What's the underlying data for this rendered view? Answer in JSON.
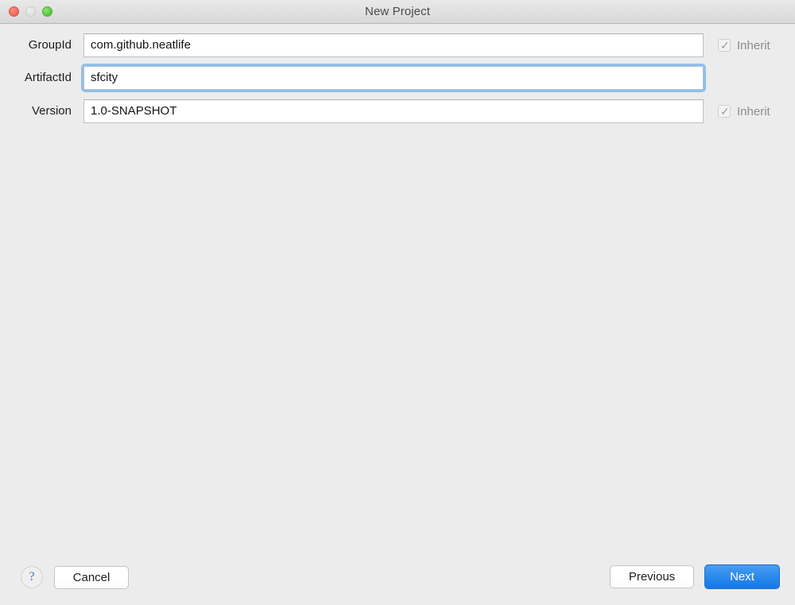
{
  "window": {
    "title": "New Project",
    "traffic_lights": [
      {
        "name": "close",
        "color": "#ee6a5f",
        "enabled": true
      },
      {
        "name": "minimize",
        "color": "#e2e2e2",
        "enabled": false
      },
      {
        "name": "zoom",
        "color": "#61c64a",
        "enabled": true
      }
    ]
  },
  "form": {
    "fields": [
      {
        "label": "GroupId",
        "value": "com.github.neatlife",
        "placeholder": "",
        "focused": false,
        "inherit": {
          "label": "Inherit",
          "checked": true,
          "enabled": false
        }
      },
      {
        "label": "ArtifactId",
        "value": "sfcity",
        "placeholder": "",
        "focused": true,
        "inherit": null
      },
      {
        "label": "Version",
        "value": "1.0-SNAPSHOT",
        "placeholder": "",
        "focused": false,
        "inherit": {
          "label": "Inherit",
          "checked": true,
          "enabled": false
        }
      }
    ]
  },
  "footer": {
    "help_label": "?",
    "cancel_label": "Cancel",
    "previous_label": "Previous",
    "next_label": "Next",
    "checkbox_glyph": "✓"
  },
  "colors": {
    "background": "#ececec",
    "titlebar_top": "#e9e9e9",
    "titlebar_bottom": "#d8d8d8",
    "accent_blue": "#2a8aec",
    "focus_ring": "#93bfe8",
    "help_blue": "#4a74b5",
    "disabled_text": "#8c8c8c"
  }
}
